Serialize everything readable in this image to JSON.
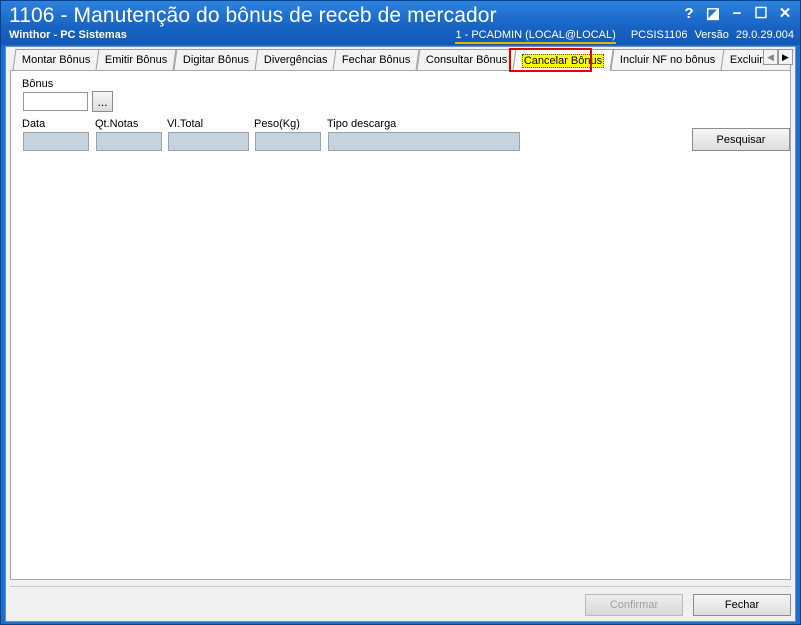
{
  "window": {
    "title": "1106 - Manutenção do bônus de receb de mercador",
    "subtitle": "Winthor - PC Sistemas",
    "user": "1 - PCADMIN (LOCAL@LOCAL)",
    "routine": "PCSIS1106",
    "version_label": "Versão",
    "version": "29.0.29.004",
    "controls": {
      "help": "?",
      "restore": "◪",
      "minimize": "−",
      "maximize": "☐",
      "close": "✕"
    }
  },
  "tabs": [
    {
      "label": "Montar Bônus"
    },
    {
      "label": "Emitir Bônus"
    },
    {
      "label": "Digitar Bônus"
    },
    {
      "label": "Divergências"
    },
    {
      "label": "Fechar Bônus"
    },
    {
      "label": "Consultar Bônus"
    },
    {
      "label": "Cancelar Bônus"
    },
    {
      "label": "Incluir NF no bônus"
    },
    {
      "label": "Excluir NF de"
    }
  ],
  "active_tab": "Cancelar Bônus",
  "tab_scroll": {
    "left": "◀",
    "right": "▶"
  },
  "form": {
    "bonus_label": "Bônus",
    "bonus_value": "",
    "lookup_button": "...",
    "columns": {
      "data": "Data",
      "qt_notas": "Qt.Notas",
      "vl_total": "Vl.Total",
      "peso": "Peso(Kg)",
      "tipo_descarga": "Tipo descarga"
    },
    "search_button": "Pesquisar"
  },
  "footer": {
    "confirm_button": "Confirmar",
    "close_button": "Fechar"
  },
  "colors": {
    "titlebar": "#1763c3",
    "readonly_field": "#c5d3df",
    "highlight": "#e00000",
    "active_tab_bg": "#ffff00"
  }
}
